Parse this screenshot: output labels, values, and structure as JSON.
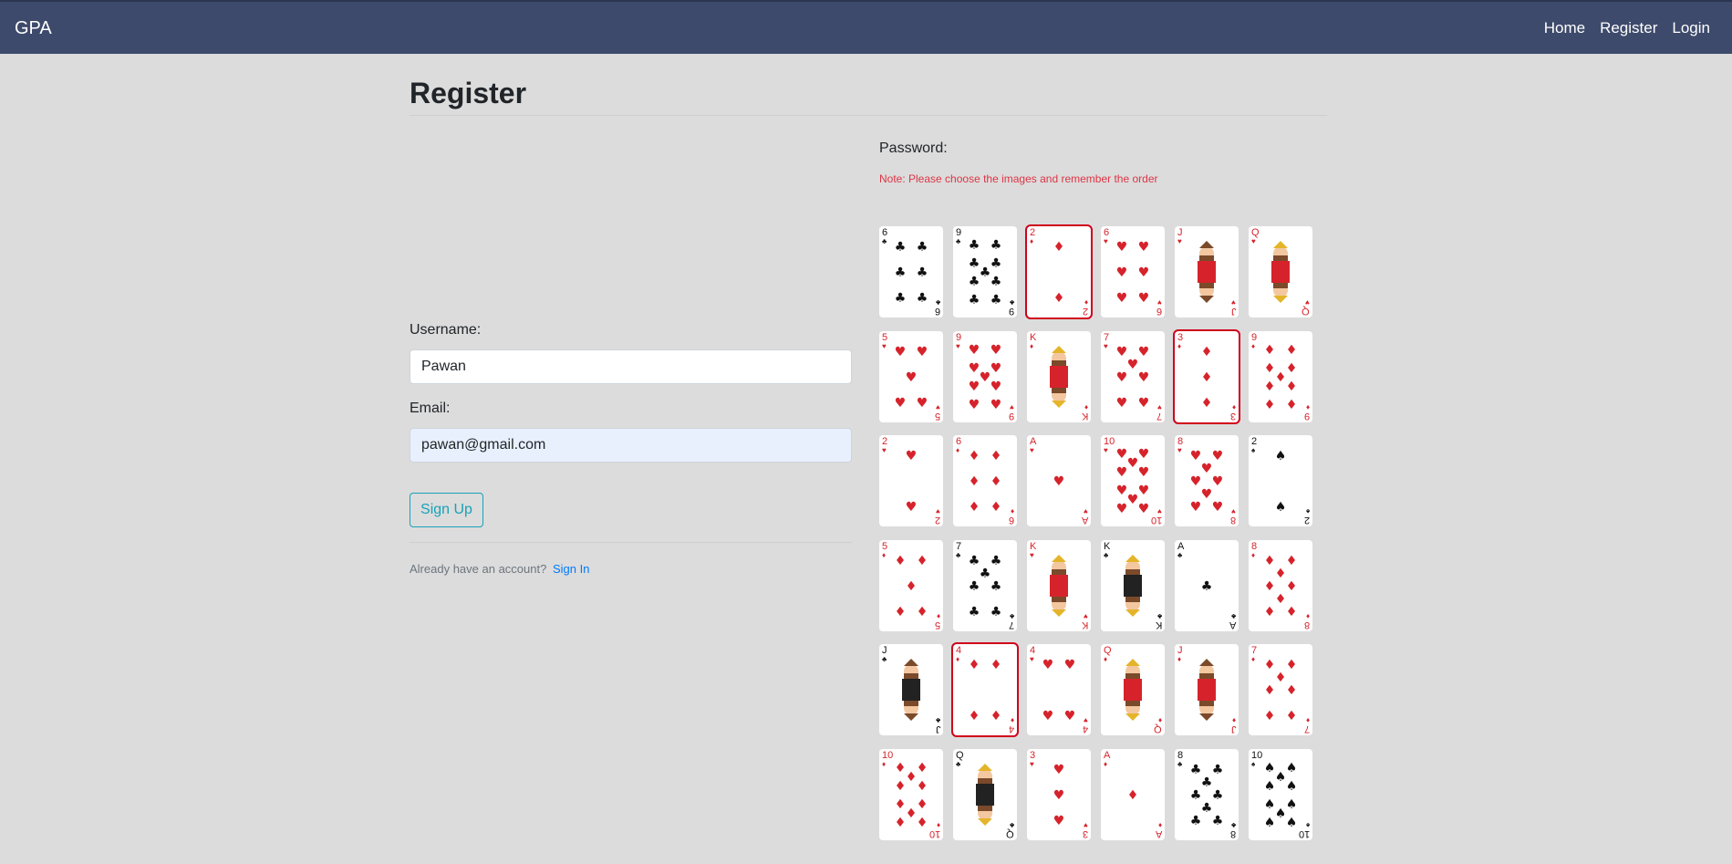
{
  "nav": {
    "brand": "GPA",
    "links": [
      "Home",
      "Register",
      "Login"
    ]
  },
  "page": {
    "title": "Register"
  },
  "form": {
    "username_label": "Username:",
    "username_value": "Pawan",
    "email_label": "Email:",
    "email_value": "pawan@gmail.com",
    "signup_label": "Sign Up",
    "already_text": "Already have an account?",
    "signin_label": "Sign In"
  },
  "password": {
    "label": "Password:",
    "note": "Note: Please choose the images and remember the order"
  },
  "cards": [
    {
      "rank": "6",
      "suit": "clubs",
      "selected": false
    },
    {
      "rank": "9",
      "suit": "clubs",
      "selected": false
    },
    {
      "rank": "2",
      "suit": "diamonds",
      "selected": true
    },
    {
      "rank": "6",
      "suit": "hearts",
      "selected": false
    },
    {
      "rank": "J",
      "suit": "hearts",
      "selected": false
    },
    {
      "rank": "Q",
      "suit": "hearts",
      "selected": false
    },
    {
      "rank": "5",
      "suit": "hearts",
      "selected": false
    },
    {
      "rank": "9",
      "suit": "hearts",
      "selected": false
    },
    {
      "rank": "K",
      "suit": "diamonds",
      "selected": false
    },
    {
      "rank": "7",
      "suit": "hearts",
      "selected": false
    },
    {
      "rank": "3",
      "suit": "diamonds",
      "selected": true
    },
    {
      "rank": "9",
      "suit": "diamonds",
      "selected": false
    },
    {
      "rank": "2",
      "suit": "hearts",
      "selected": false
    },
    {
      "rank": "6",
      "suit": "diamonds",
      "selected": false
    },
    {
      "rank": "A",
      "suit": "hearts",
      "selected": false
    },
    {
      "rank": "10",
      "suit": "hearts",
      "selected": false
    },
    {
      "rank": "8",
      "suit": "hearts",
      "selected": false
    },
    {
      "rank": "2",
      "suit": "spades",
      "selected": false
    },
    {
      "rank": "5",
      "suit": "diamonds",
      "selected": false
    },
    {
      "rank": "7",
      "suit": "clubs",
      "selected": false
    },
    {
      "rank": "K",
      "suit": "hearts",
      "selected": false
    },
    {
      "rank": "K",
      "suit": "clubs",
      "selected": false
    },
    {
      "rank": "A",
      "suit": "clubs",
      "selected": false
    },
    {
      "rank": "8",
      "suit": "diamonds",
      "selected": false
    },
    {
      "rank": "J",
      "suit": "clubs",
      "selected": false
    },
    {
      "rank": "4",
      "suit": "diamonds",
      "selected": true
    },
    {
      "rank": "4",
      "suit": "hearts",
      "selected": false
    },
    {
      "rank": "Q",
      "suit": "diamonds",
      "selected": false
    },
    {
      "rank": "J",
      "suit": "diamonds",
      "selected": false
    },
    {
      "rank": "7",
      "suit": "diamonds",
      "selected": false
    },
    {
      "rank": "10",
      "suit": "diamonds",
      "selected": false
    },
    {
      "rank": "Q",
      "suit": "clubs",
      "selected": false
    },
    {
      "rank": "3",
      "suit": "hearts",
      "selected": false
    },
    {
      "rank": "A",
      "suit": "diamonds",
      "selected": false
    },
    {
      "rank": "8",
      "suit": "clubs",
      "selected": false
    },
    {
      "rank": "10",
      "suit": "spades",
      "selected": false
    }
  ],
  "colors": {
    "navbar": "#3d4a6b",
    "background": "#dcdcdc",
    "note": "#dc3545",
    "selected_outline": "#d0021b",
    "signup_outline": "#17a2b8",
    "link": "#007bff",
    "red_suit": "#d6232b",
    "black_suit": "#111111"
  }
}
